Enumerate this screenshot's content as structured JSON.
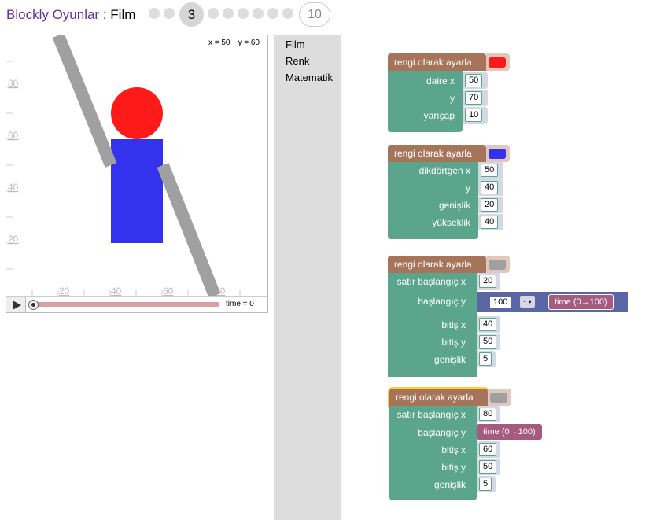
{
  "header": {
    "app_title": "Blockly Oyunlar",
    "separator": " : ",
    "level_name": "Film",
    "current_level": "3",
    "last_level": "10"
  },
  "viz": {
    "coord_x": "x = 50",
    "coord_y": "y = 60",
    "time_label": "time = 0",
    "y_ticks": [
      "80",
      "60",
      "40",
      "20"
    ],
    "x_ticks": [
      "20",
      "40",
      "60",
      "80"
    ],
    "time_progress": 0
  },
  "toolbox": {
    "items": [
      "Film",
      "Renk",
      "Matematik"
    ]
  },
  "colors": {
    "red": "#ff1a1a",
    "blue": "#3333ee",
    "grey": "#a0a0a0",
    "block_colour": "#a5745b",
    "block_draw": "#5ba58c",
    "block_math": "#5b67a5",
    "block_time": "#a55b80"
  },
  "blocks": {
    "b1": {
      "header": "rengi olarak ayarla",
      "draw": "daire x",
      "x": "50",
      "y_label": "y",
      "y": "70",
      "r_label": "yarıçap",
      "r": "10"
    },
    "b2": {
      "header": "rengi olarak ayarla",
      "draw": "dikdörtgen x",
      "x": "50",
      "y_label": "y",
      "y": "40",
      "w_label": "genişlik",
      "w": "20",
      "h_label": "yükseklik",
      "h": "40"
    },
    "b3": {
      "header": "rengi olarak ayarla",
      "draw": "satır başlangıç x",
      "x1": "20",
      "y1_label": "başlangıç y",
      "y1_num": "100",
      "y1_op": "-",
      "y1_time": "time (0→100)",
      "x2_label": "bitiş x",
      "x2": "40",
      "y2_label": "bitiş y",
      "y2": "50",
      "w_label": "genişlik",
      "w": "5"
    },
    "b4": {
      "header": "rengi olarak ayarla",
      "draw": "satır başlangıç x",
      "x1": "80",
      "y1_label": "başlangıç y",
      "y1_time": "time (0→100)",
      "x2_label": "bitiş x",
      "x2": "60",
      "y2_label": "bitiş y",
      "y2": "50",
      "w_label": "genişlik",
      "w": "5"
    }
  }
}
